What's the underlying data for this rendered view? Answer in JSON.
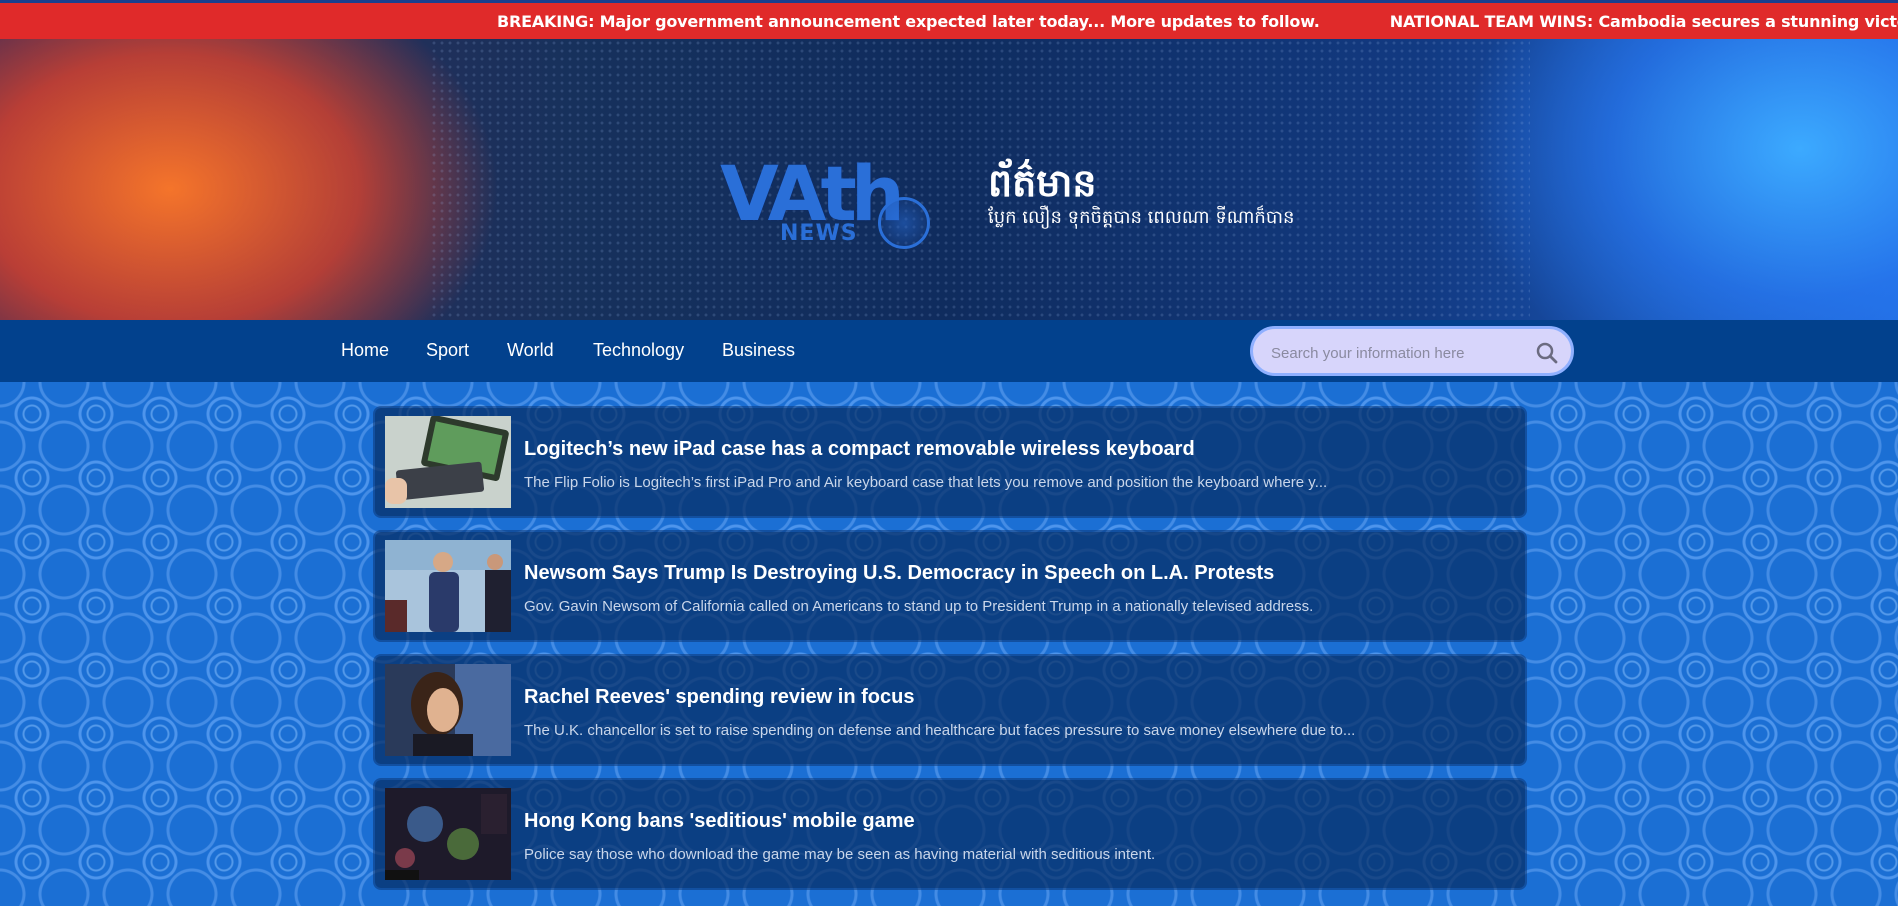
{
  "ticker": {
    "items": [
      "BREAKING: Major government announcement expected later today... More updates to follow.",
      "NATIONAL TEAM WINS: Cambodia secures a stunning victory in the regional football finals."
    ]
  },
  "header": {
    "logo_text": "VAth",
    "logo_sub": "NEWS",
    "title": "ព័ត៌មាន",
    "tagline": "ប្លែក លឿន ទុកចិត្តបាន ពេលណា ទីណាក៏បាន"
  },
  "nav": {
    "items": [
      "Home",
      "Sport",
      "World",
      "Technology",
      "Business"
    ]
  },
  "search": {
    "placeholder": "Search your information here",
    "icon": "search-icon"
  },
  "news": [
    {
      "title": "Logitech’s new iPad case has a compact removable wireless keyboard",
      "description": "The Flip Folio is Logitech’s first iPad Pro and Air keyboard case that lets you remove and position the keyboard where y..."
    },
    {
      "title": "Newsom Says Trump Is Destroying U.S. Democracy in Speech on L.A. Protests",
      "description": "Gov. Gavin Newsom of California called on Americans to stand up to President Trump in a nationally televised address."
    },
    {
      "title": "Rachel Reeves' spending review in focus",
      "description": "The U.K. chancellor is set to raise spending on defense and healthcare but faces pressure to save money elsewhere due to..."
    },
    {
      "title": "Hong Kong bans 'seditious' mobile game",
      "description": "Police say those who download the game may be seen as having material with seditious intent."
    }
  ],
  "colors": {
    "ticker_bg": "#e02a2a",
    "nav_bg": "#02418d",
    "card_bg": "#062d64",
    "pattern_bg": "#1b6fd4"
  }
}
